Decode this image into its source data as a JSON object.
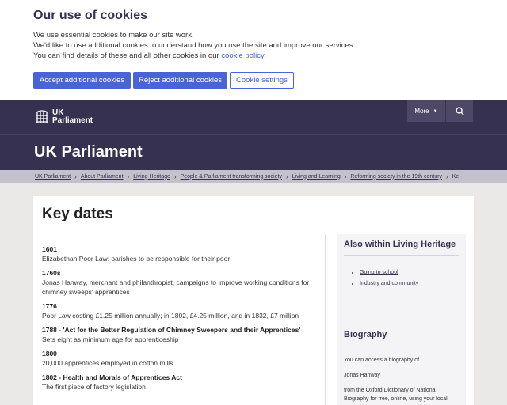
{
  "cookie": {
    "title": "Our use of cookies",
    "line1": "We use essential cookies to make our site work.",
    "line2": "We'd like to use additional cookies to understand how you use the site and improve our services.",
    "line3_prefix": "You can find details of these and all other cookies in our ",
    "policy_link": "cookie policy",
    "line3_suffix": ".",
    "accept_label": "Accept additional cookies",
    "reject_label": "Reject additional cookies",
    "settings_label": "Cookie settings"
  },
  "header": {
    "logo_line1": "UK",
    "logo_line2": "Parliament",
    "more_label": "More",
    "page_title": "UK Parliament"
  },
  "breadcrumb": [
    "UK Parliament",
    "About Parliament",
    "Living Heritage",
    "People & Parliament transforming society",
    "Living and Learning",
    "Reforming society in the 19th century",
    "Ke"
  ],
  "main": {
    "heading": "Key dates",
    "entries": [
      {
        "year": "1601",
        "desc": "Elizabethan Poor Law: parishes to be responsible for their poor"
      },
      {
        "year": "1760s",
        "desc": "Jonas Hanway, merchant and philanthropist, campaigns to improve working conditions for chimney sweeps' apprentices"
      },
      {
        "year": "1776",
        "desc": "Poor Law costing £1.25 million annually; in 1802, £4.25 million, and in 1832, £7 million"
      },
      {
        "year": "1788 - 'Act for the Better Regulation of Chimney Sweepers and their Apprentices'",
        "desc": "Sets eight as minimum age for apprenticeship"
      },
      {
        "year": "1800",
        "desc": "20,000 apprentices employed in cotton mills"
      },
      {
        "year": "1802 - Health and Morals of Apprentices Act",
        "desc": "The first piece of factory legislation"
      }
    ]
  },
  "sidebar": {
    "box1": {
      "title": "Also within Living Heritage",
      "links": [
        "Going to school",
        "Industry and community"
      ]
    },
    "box2": {
      "title": "Biography",
      "p1": "You can access a biography of",
      "p2": "Jonas Hanway",
      "p3": "from the Oxford Dictionary of National Biography for free, online, using your local"
    }
  }
}
